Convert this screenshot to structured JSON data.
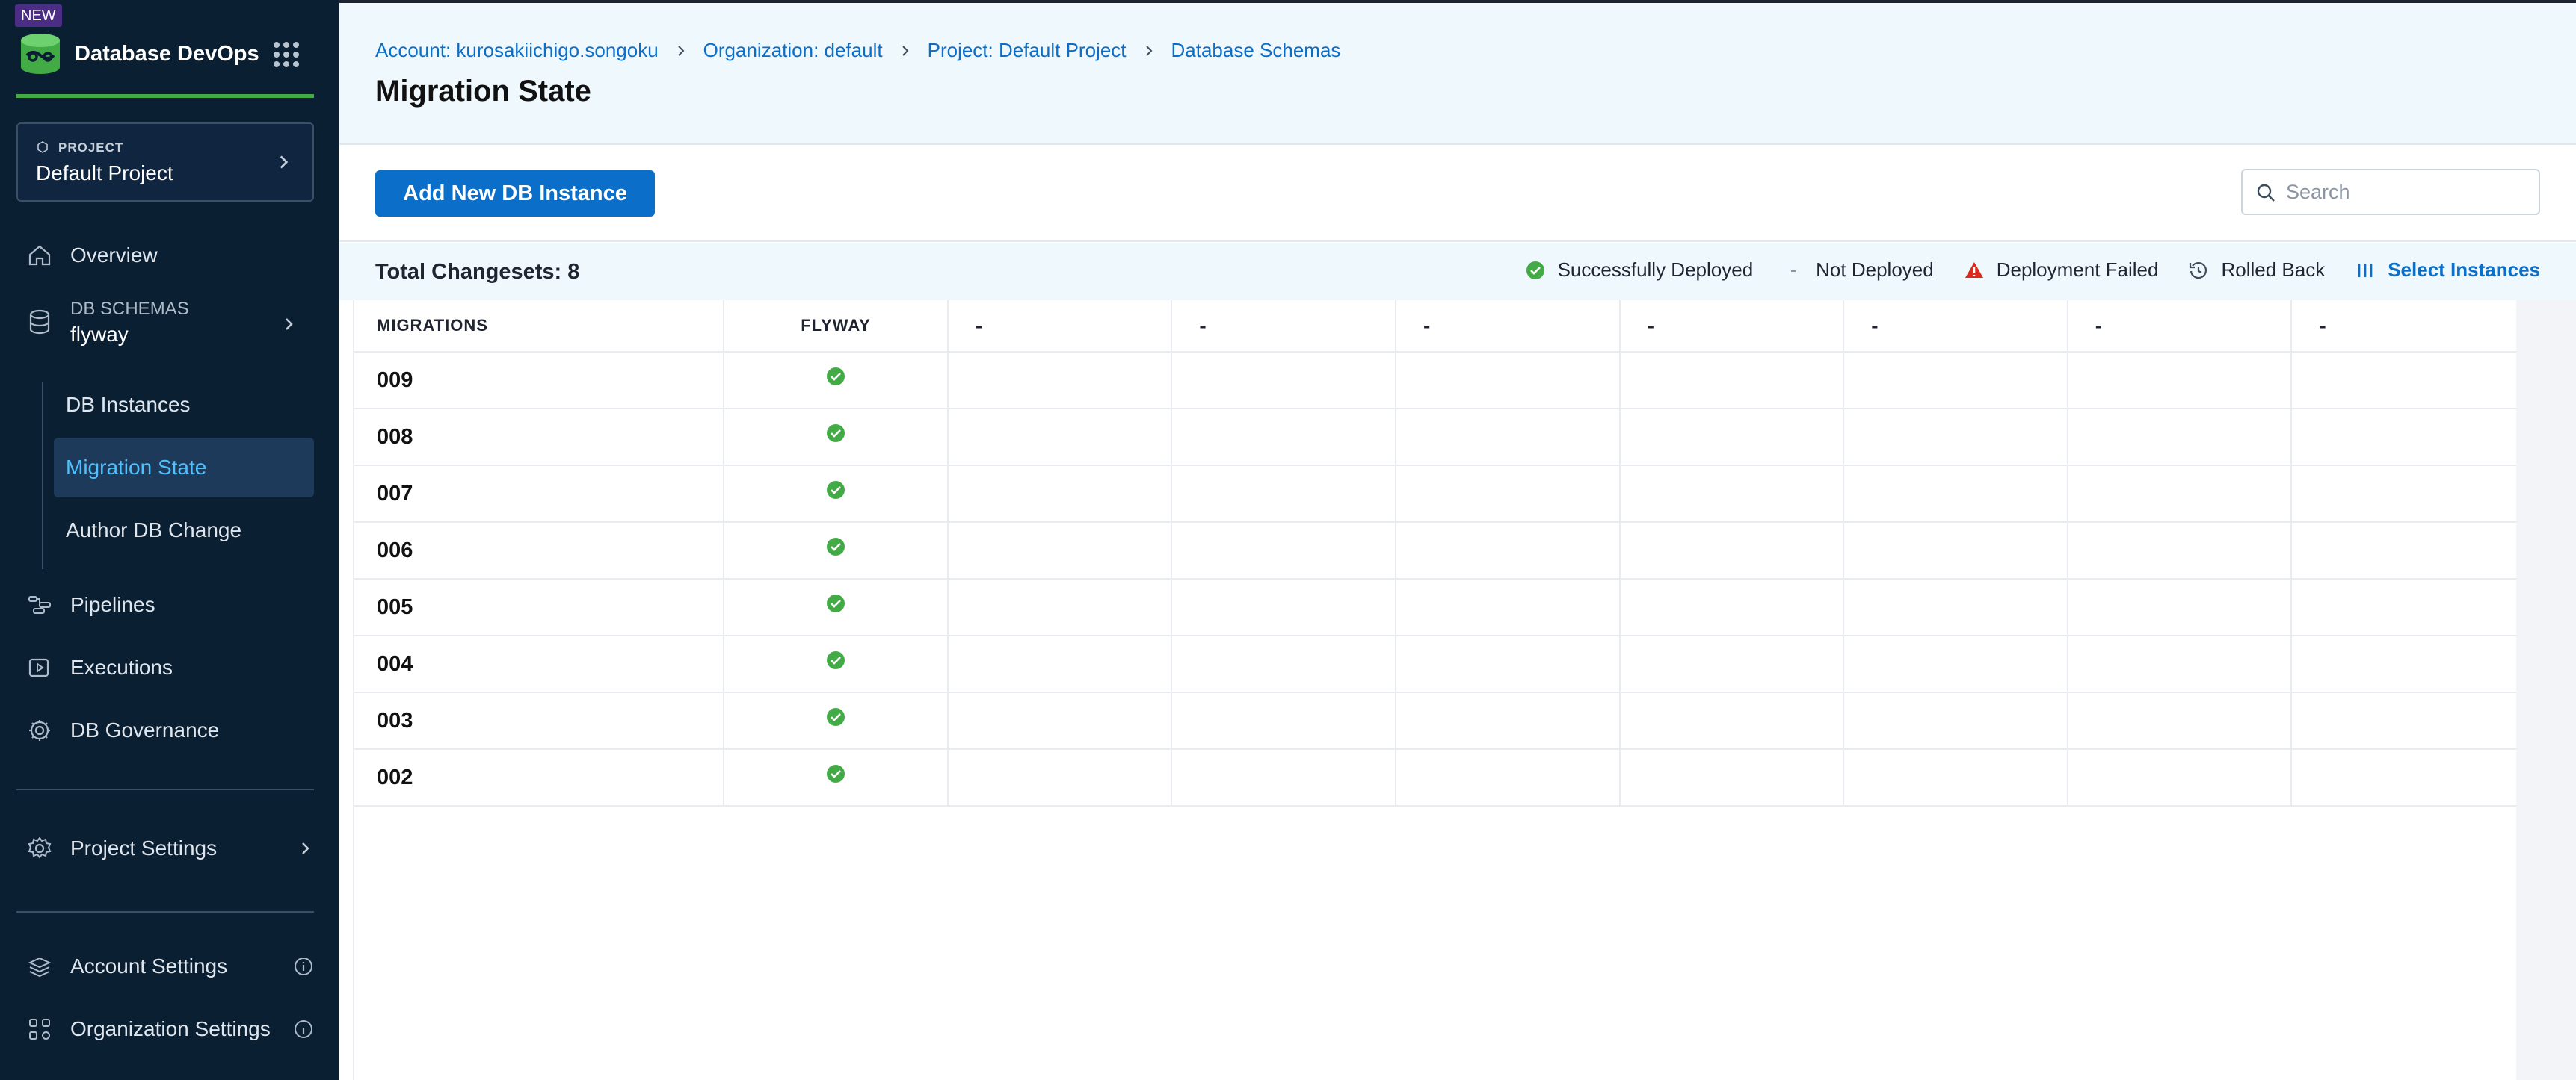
{
  "sidebar": {
    "new_badge": "NEW",
    "module_title": "Database DevOps",
    "project": {
      "kicker": "PROJECT",
      "name": "Default Project"
    },
    "nav": {
      "overview": "Overview",
      "db_schemas_kicker": "DB SCHEMAS",
      "db_schemas_value": "flyway",
      "db_instances": "DB Instances",
      "migration_state": "Migration State",
      "author_db_change": "Author DB Change",
      "pipelines": "Pipelines",
      "executions": "Executions",
      "db_governance": "DB Governance",
      "project_settings": "Project Settings",
      "account_settings": "Account Settings",
      "organization_settings": "Organization Settings"
    }
  },
  "breadcrumb": {
    "account": "Account: kurosakiichigo.songoku",
    "organization": "Organization: default",
    "project": "Project: Default Project",
    "schemas": "Database Schemas"
  },
  "page_title": "Migration State",
  "toolbar": {
    "add_button": "Add New DB Instance",
    "search_placeholder": "Search"
  },
  "summary": {
    "total": "Total Changesets: 8",
    "legend": {
      "success": "Successfully Deployed",
      "not_deployed_symbol": "-",
      "not_deployed": "Not Deployed",
      "failed": "Deployment Failed",
      "rolled_back": "Rolled Back",
      "select_instances": "Select Instances"
    }
  },
  "colors": {
    "accent": "#0b6ec8",
    "success": "#42ab45",
    "failed": "#da291d",
    "sidebar_bg": "#0b1f33",
    "header_bg": "#eef8fd"
  },
  "table": {
    "headers": {
      "migrations": "MIGRATIONS",
      "flyway": "FLYWAY",
      "instances": [
        "-",
        "-",
        "-",
        "-",
        "-",
        "-",
        "-"
      ]
    },
    "rows": [
      {
        "migration": "009",
        "flyway_status": "success"
      },
      {
        "migration": "008",
        "flyway_status": "success"
      },
      {
        "migration": "007",
        "flyway_status": "success"
      },
      {
        "migration": "006",
        "flyway_status": "success"
      },
      {
        "migration": "005",
        "flyway_status": "success"
      },
      {
        "migration": "004",
        "flyway_status": "success"
      },
      {
        "migration": "003",
        "flyway_status": "success"
      },
      {
        "migration": "002",
        "flyway_status": "success"
      }
    ]
  }
}
